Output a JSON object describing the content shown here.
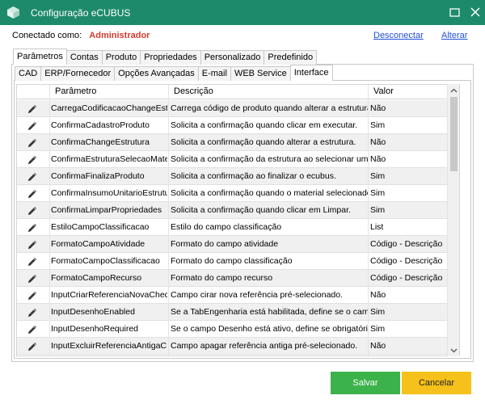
{
  "window": {
    "title": "Configuração eCUBUS",
    "minimize_icon": "minimize-icon",
    "close_icon": "close-icon",
    "accent_color": "#1e8a6c"
  },
  "connection": {
    "label": "Conectado como:",
    "user": "Administrador",
    "disconnect": "Desconectar",
    "change": "Alterar"
  },
  "tabs_primary": [
    "Parâmetros",
    "Contas",
    "Produto",
    "Propriedades",
    "Personalizado",
    "Predefinido"
  ],
  "tabs_primary_active": "Parâmetros",
  "tabs_secondary": [
    "CAD",
    "ERP/Fornecedor",
    "Opções Avançadas",
    "E-mail",
    "WEB Service",
    "Interface"
  ],
  "tabs_secondary_active": "Interface",
  "grid": {
    "columns": [
      "Parâmetro",
      "Descrição",
      "Valor"
    ],
    "row_icon": "pencil-icon",
    "rows": [
      {
        "param": "CarregaCodificacaoChangeEstr...",
        "desc": "Carrega código de produto quando alterar a estrutura ...",
        "value": "Não"
      },
      {
        "param": "ConfirmaCadastroProduto",
        "desc": "Solicita a confirmação quando clicar em executar.",
        "value": "Sim"
      },
      {
        "param": "ConfirmaChangeEstrutura",
        "desc": "Solicita a confirmação quando alterar a estrutura.",
        "value": "Não"
      },
      {
        "param": "ConfirmaEstruturaSelecaoMate...",
        "desc": "Solicita a confirmação da estrutura ao selecionar um m...",
        "value": "Não"
      },
      {
        "param": "ConfirmaFinalizaProduto",
        "desc": "Solicita a confirmação ao finalizar o ecubus.",
        "value": "Sim"
      },
      {
        "param": "ConfirmaInsumoUnitarioEstrutur...",
        "desc": "Solicita a confirmação quando o material selecionado f...",
        "value": "Sim"
      },
      {
        "param": "ConfirmaLimparPropriedades",
        "desc": "Solicita a confirmação quando clicar em Limpar.",
        "value": "Sim"
      },
      {
        "param": "EstiloCampoClassificacao",
        "desc": "Estilo do campo classificação",
        "value": "List"
      },
      {
        "param": "FormatoCampoAtividade",
        "desc": "Formato do campo atividade",
        "value": "Código - Descrição"
      },
      {
        "param": "FormatoCampoClassificacao",
        "desc": "Formato do campo classificação",
        "value": "Código - Descrição"
      },
      {
        "param": "FormatoCampoRecurso",
        "desc": "Formato do campo recurso",
        "value": "Código - Descrição"
      },
      {
        "param": "InputCriarReferenciaNovaChec...",
        "desc": "Campo cirar nova referência pré-selecionado.",
        "value": "Não"
      },
      {
        "param": "InputDesenhoEnabled",
        "desc": "Se a TabEngenharia está habilitada, define se o camp...",
        "value": "Sim"
      },
      {
        "param": "InputDesenhoRequired",
        "desc": "Se o campo Desenho está ativo, define se obrigatório.",
        "value": "Sim"
      },
      {
        "param": "InputExcluirReferenciaAntigaC...",
        "desc": "Campo apagar referência antiga pré-selecionado.",
        "value": "Não"
      }
    ]
  },
  "buttons": {
    "save": "Salvar",
    "cancel": "Cancelar",
    "save_color": "#3cb24a",
    "cancel_color": "#f5c11a"
  }
}
